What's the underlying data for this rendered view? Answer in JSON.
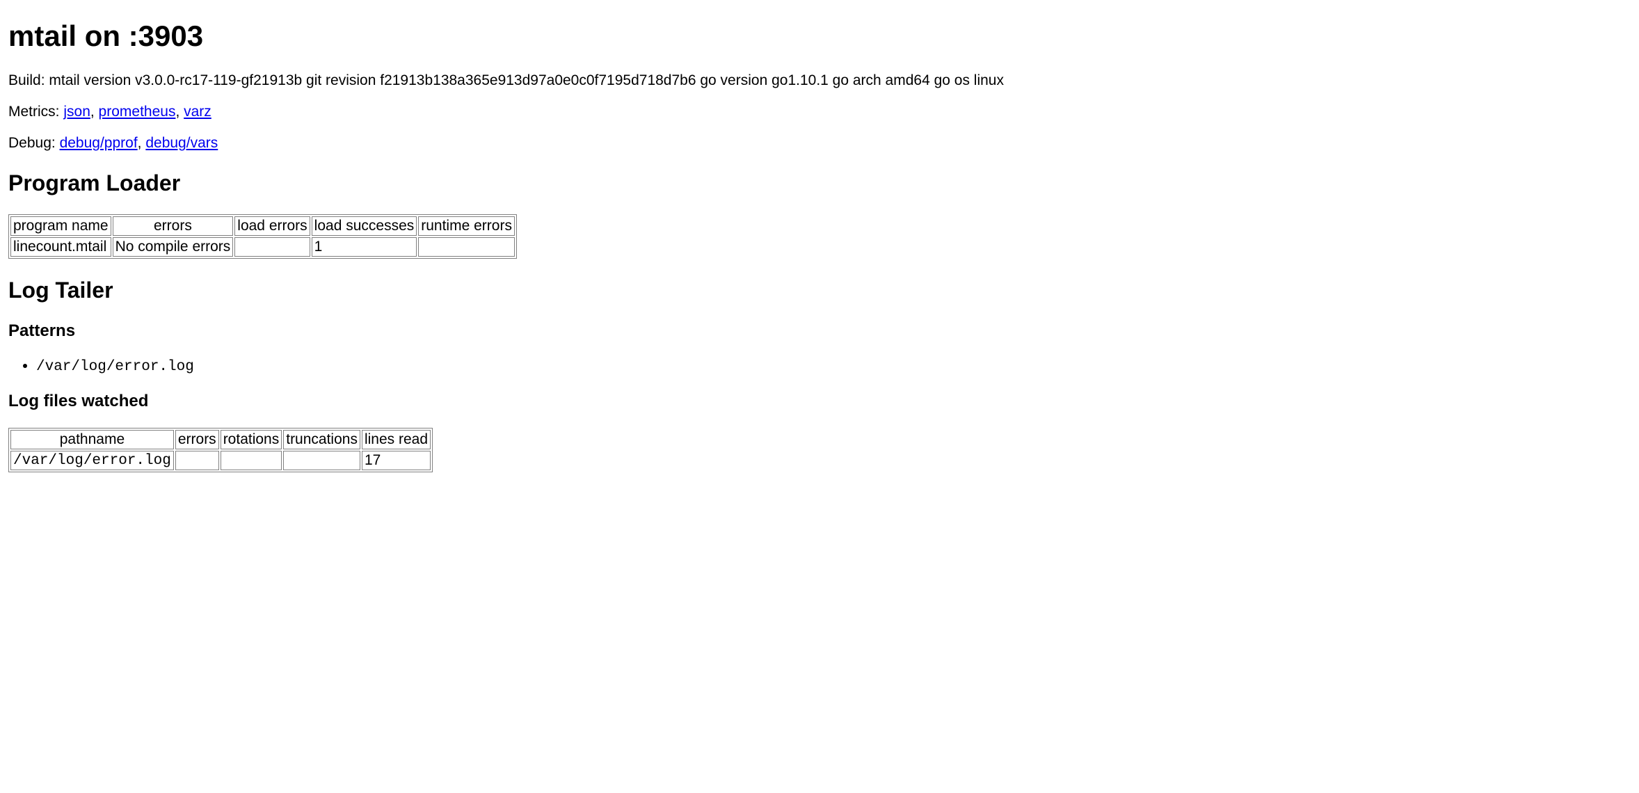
{
  "title": "mtail on :3903",
  "build_label": "Build: ",
  "build_info": "mtail version v3.0.0-rc17-119-gf21913b git revision f21913b138a365e913d97a0e0c0f7195d718d7b6 go version go1.10.1 go arch amd64 go os linux",
  "metrics_label": "Metrics: ",
  "metrics_links": {
    "json": "json",
    "sep1": ", ",
    "prometheus": "prometheus",
    "sep2": ", ",
    "varz": "varz"
  },
  "debug_label": "Debug: ",
  "debug_links": {
    "pprof": "debug/pprof",
    "sep": ", ",
    "vars": "debug/vars"
  },
  "program_loader": {
    "heading": "Program Loader",
    "headers": {
      "program_name": "program name",
      "errors": "errors",
      "load_errors": "load errors",
      "load_successes": "load successes",
      "runtime_errors": "runtime errors"
    },
    "rows": [
      {
        "program_name": "linecount.mtail",
        "errors": "No compile errors",
        "load_errors": "",
        "load_successes": "1",
        "runtime_errors": ""
      }
    ]
  },
  "log_tailer": {
    "heading": "Log Tailer",
    "patterns_heading": "Patterns",
    "patterns": [
      "/var/log/error.log"
    ],
    "files_heading": "Log files watched",
    "files_headers": {
      "pathname": "pathname",
      "errors": "errors",
      "rotations": "rotations",
      "truncations": "truncations",
      "lines_read": "lines read"
    },
    "files_rows": [
      {
        "pathname": "/var/log/error.log",
        "errors": "",
        "rotations": "",
        "truncations": "",
        "lines_read": "17"
      }
    ]
  }
}
